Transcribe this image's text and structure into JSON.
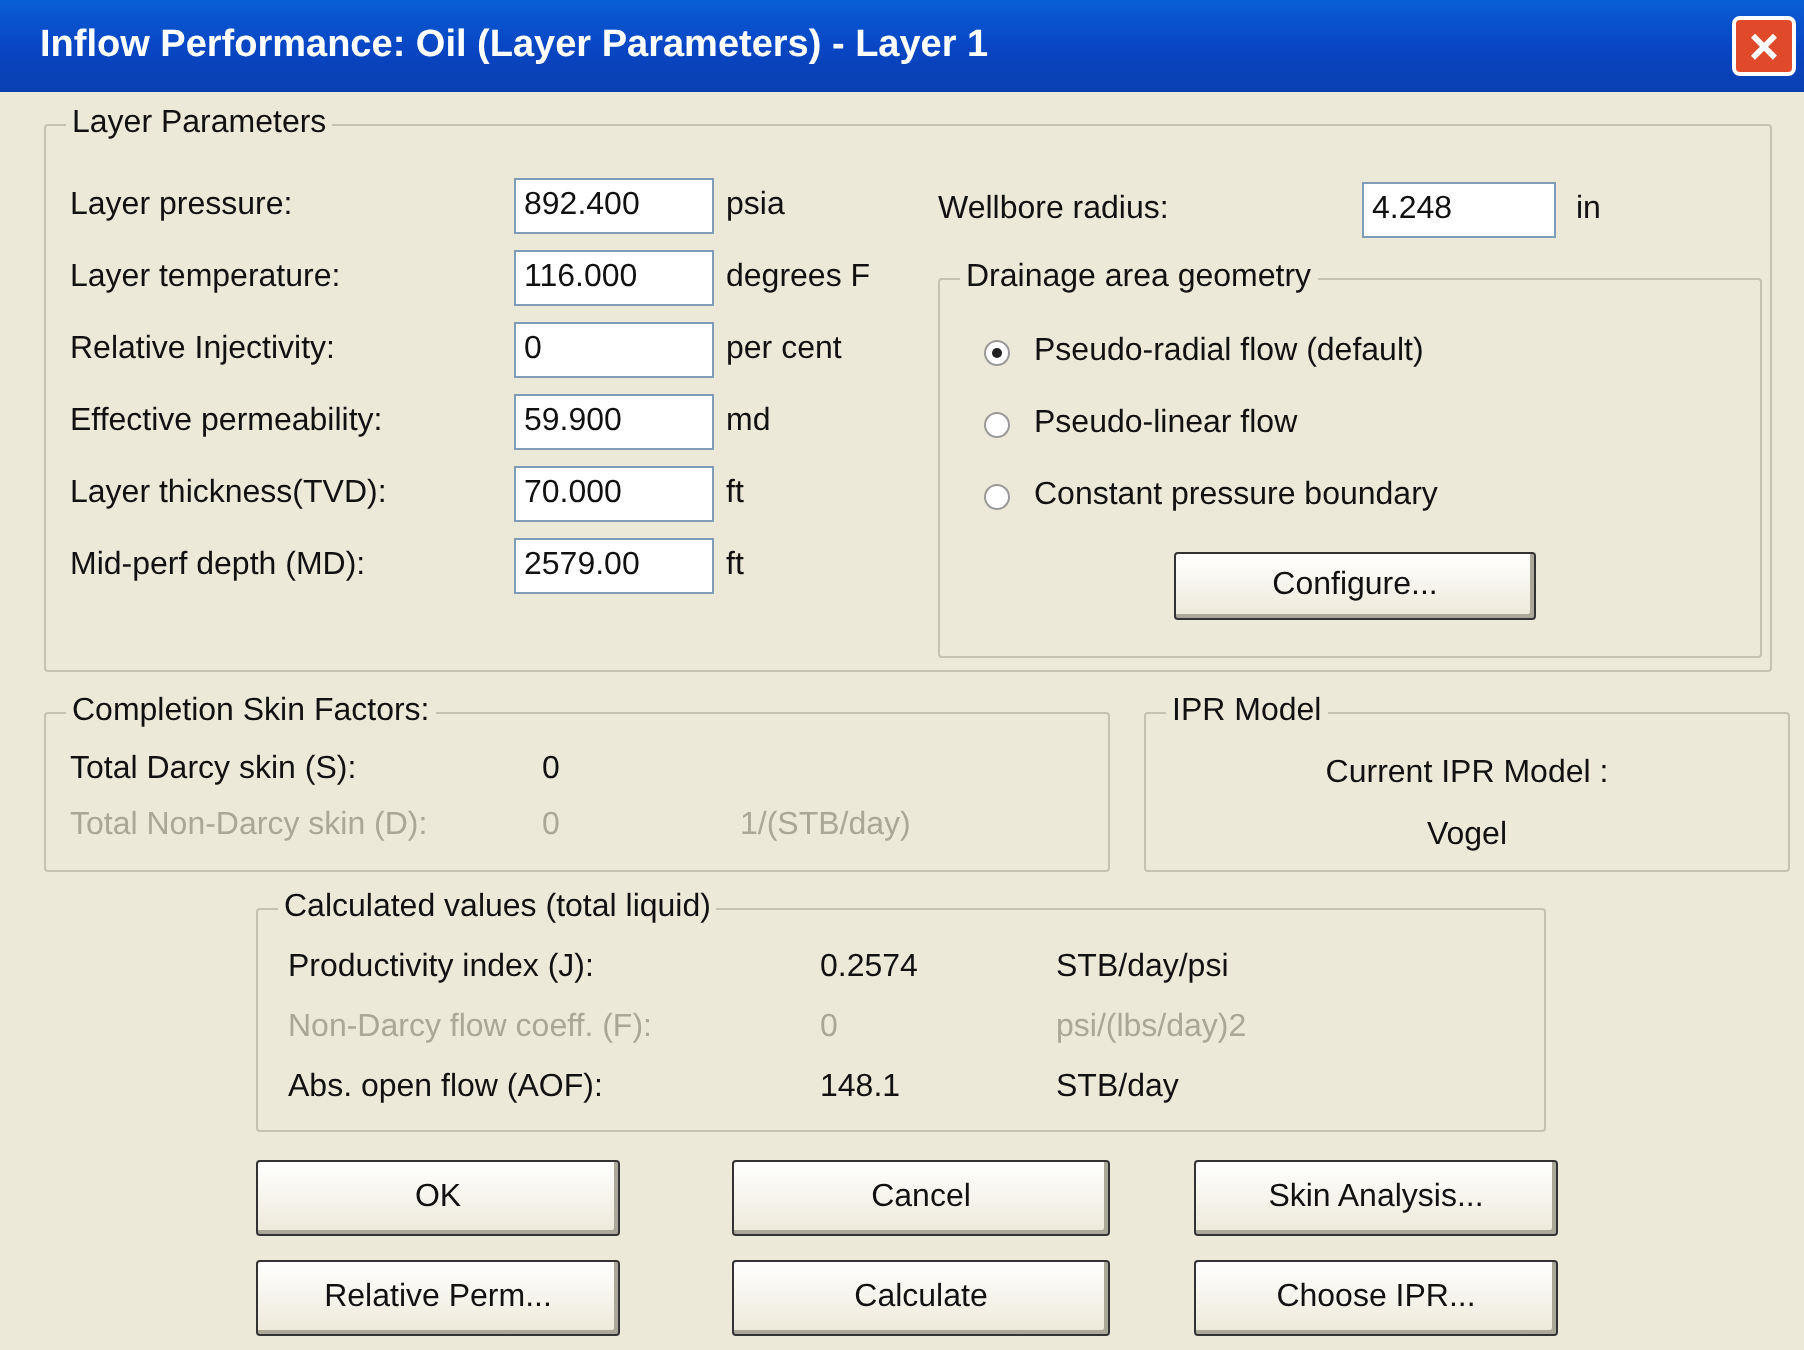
{
  "window": {
    "title": "Inflow Performance: Oil (Layer Parameters) - Layer 1",
    "close": "×"
  },
  "layer_parameters": {
    "title": "Layer Parameters",
    "fields": [
      {
        "label": "Layer pressure:",
        "value": "892.400",
        "unit": "psia"
      },
      {
        "label": "Layer temperature:",
        "value": "116.000",
        "unit": "degrees F"
      },
      {
        "label": "Relative Injectivity:",
        "value": "0",
        "unit": "per cent"
      },
      {
        "label": "Effective permeability:",
        "value": "59.900",
        "unit": "md"
      },
      {
        "label": "Layer thickness(TVD):",
        "value": "70.000",
        "unit": "ft"
      },
      {
        "label": "Mid-perf depth (MD):",
        "value": "2579.00",
        "unit": "ft"
      }
    ],
    "wellbore_radius": {
      "label": "Wellbore radius:",
      "value": "4.248",
      "unit": "in"
    },
    "drainage": {
      "title": "Drainage area geometry",
      "options": [
        {
          "label": "Pseudo-radial flow (default)",
          "selected": true
        },
        {
          "label": "Pseudo-linear flow",
          "selected": false
        },
        {
          "label": "Constant pressure boundary",
          "selected": false
        }
      ],
      "button": "Configure..."
    }
  },
  "completion_skin": {
    "title": "Completion Skin Factors:",
    "rows": [
      {
        "label": "Total Darcy skin (S):",
        "value": "0",
        "disabled": false
      },
      {
        "label": "Total Non-Darcy skin (D):",
        "value": "0",
        "unit": "1/(STB/day)",
        "disabled": true
      }
    ]
  },
  "ipr_model": {
    "title": "IPR Model",
    "label": "Current IPR Model :",
    "value": "Vogel"
  },
  "calculated": {
    "title": "Calculated values (total liquid)",
    "rows": [
      {
        "label": "Productivity index (J):",
        "value": "0.2574",
        "unit": "STB/day/psi",
        "disabled": false
      },
      {
        "label": "Non-Darcy flow coeff. (F):",
        "value": "0",
        "unit": "psi/(lbs/day)2",
        "disabled": true
      },
      {
        "label": "Abs. open flow (AOF):",
        "value": "148.1",
        "unit": "STB/day",
        "disabled": false
      }
    ]
  },
  "buttons": [
    [
      "OK",
      "Cancel",
      "Skin Analysis..."
    ],
    [
      "Relative Perm...",
      "Calculate",
      "Choose IPR..."
    ]
  ]
}
